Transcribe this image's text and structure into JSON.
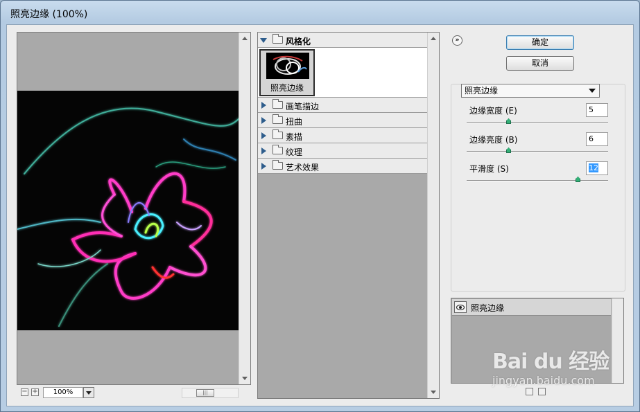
{
  "window": {
    "title": "照亮边缘 (100%)"
  },
  "preview": {
    "zoom": "100%",
    "zoom_out": "−",
    "zoom_in": "+",
    "hscroll_thumb": "|||"
  },
  "filter_gallery": {
    "open_group": {
      "label": "风格化",
      "thumbnail_label": "照亮边缘"
    },
    "groups": [
      "画笔描边",
      "扭曲",
      "素描",
      "纹理",
      "艺术效果"
    ]
  },
  "buttons": {
    "ok": "确定",
    "cancel": "取消",
    "collapse": "»"
  },
  "settings": {
    "filter_select": "照亮边缘",
    "params": [
      {
        "label": "边缘宽度 (E)",
        "value": "5",
        "slider": 0.3
      },
      {
        "label": "边缘亮度 (B)",
        "value": "6",
        "slider": 0.3
      },
      {
        "label": "平滑度 (S)",
        "value": "12",
        "slider": 0.8
      }
    ]
  },
  "layers": {
    "items": [
      "照亮边缘"
    ]
  },
  "watermark": {
    "brand": "Bai du 经验",
    "url": "jingyan.baidu.com"
  },
  "colors": {
    "accent_knob": "#33b077",
    "selection": "#3399ff"
  }
}
